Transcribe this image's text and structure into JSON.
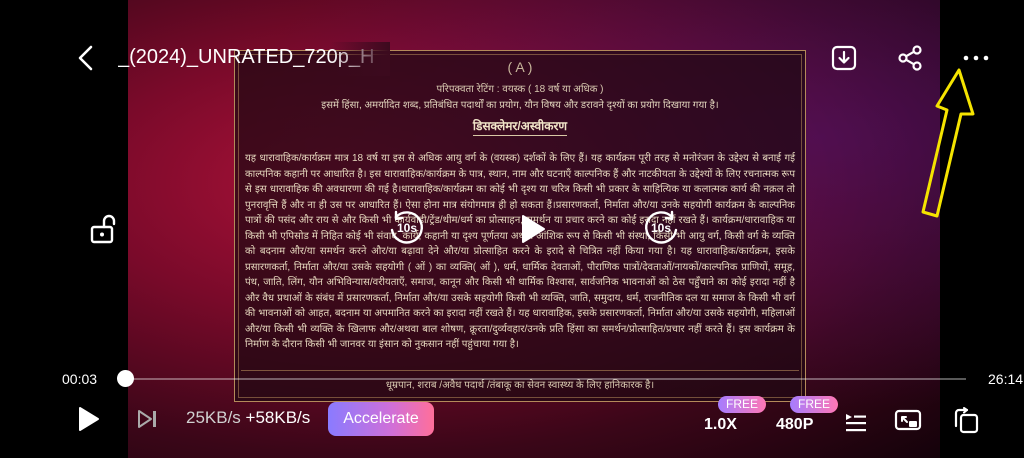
{
  "header": {
    "title": "_(2024)_UNRATED_720p_H"
  },
  "card": {
    "rating_label": "( A )",
    "maturity_line": "परिपक्वता रेटिंग : वयस्क ( 18 वर्ष या अधिक )",
    "content_line": "इसमें हिंसा, अमर्यादित शब्द, प्रतिबंधित पदार्थों का प्रयोग, यौन विषय और डरावने दृश्यों का प्रयोग दिखाया गया है।",
    "heading": "डिसक्लेमर/अस्वीकरण",
    "paragraph": "यह धारावाहिक/कार्यक्रम मात्र 18 वर्ष या इस से अधिक आयु वर्ग के (वयस्क) दर्शकों के लिए हैं। यह कार्यक्रम पूरी तरह से मनोरंजन के उद्देश्य से बनाई गई काल्पनिक कहानी पर आधारित है। इस धारावाहिक/कार्यक्रम के पात्र, स्थान, नाम और घटनाएँ काल्पनिक हैं और नाटकीयता के उद्देश्यों के लिए रचनात्मक रूप से इस धारावाहिक की अवधारणा की गई है।धारावाहिक/कार्यक्रम का कोई भी दृश्य या चरित्र किसी भी प्रकार के साहित्यिक या कलात्मक कार्य की नक़ल तो पुनरावृत्ति हैं और ना ही उस पर आधारित हैं। ऐसा होना मात्र संयोगमात्र ही हो सकता हैं।प्रसारणकर्ता, निर्माता और/या उनके सहयोगी कार्यक्रम के काल्पनिक पात्रों की पसंद और राय से और किसी भी कार्यवाही/ट्रेंड/थीम/धर्म का प्रोत्साहन, समर्थन या प्रचार करने का कोई इरादा नहीं रखते हैं। कार्यक्रम/धारावाहिक या किसी भी एपिसोड में निहित कोई भी संवाद, कार्य, कहानी या दृश्य पूर्णतया अथवा आंशिक रूप से किसी भी संस्था, किसी भी आयु वर्ग, किसी वर्ग के व्यक्ति को बदनाम और/या समर्थन करने और/या बढ़ावा देने और/या प्रोत्साहित करने के इरादे से चित्रित नहीं किया गया है। यह धारावाहिक/कार्यक्रम, इसके प्रसारणकर्ता, निर्माता और/या उसके सहयोगी ( ओं ) का व्यक्ति( ओं ), धर्म, धार्मिक देवताओं, पौराणिक पात्रों/देवताओं/नायकों/काल्पनिक प्राणियों, समूह, पंथ, जाति, लिंग, यौन अभिविन्यास/वरीयताएँ, समाज, कानून और किसी भी धार्मिक विश्वास, सार्वजनिक भावनाओं को ठेस पहुँचाने का कोई इरादा नहीं है और वैध प्रथाओं के संबंध में प्रसारणकर्ता, निर्माता और/या उसके सहयोगी किसी भी व्यक्ति, जाति, समुदाय, धर्म, राजनीतिक दल या समाज के किसी भी वर्ग की भावनाओं को आहत, बदनाम या अपमानित करने का इरादा नहीं रखते हैं। यह धारावाहिक, इसके प्रसारणकर्ता, निर्माता और/या उसके सहयोगी, महिलाओं और/या किसी भी व्यक्ति के खिलाफ और/अथवा बाल शोषण, क्रूरता/दुर्व्यवहार/उनके प्रति हिंसा का समर्थन/प्रोत्साहित/प्रचार नहीं करते हैं। इस कार्यक्रम के निर्माण के दौरान किसी भी जानवर या इंसान को नुकसान नहीं पहुंचाया गया है।",
    "footer_note": "धूम्रपान, शराब /अवैध पदार्थ /तंबाकू का सेवन स्वास्थ्य के लिए हानिकारक है।"
  },
  "controls": {
    "rewind_label": "10s",
    "forward_label": "10s"
  },
  "progress": {
    "current_time": "00:03",
    "total_time": "26:14",
    "fraction": 0.002
  },
  "bottom": {
    "speed_down": "25KB/s",
    "speed_up": "+58KB/s",
    "accelerate_label": "Accelerate",
    "free_badge_speed": "FREE",
    "free_badge_quality": "FREE",
    "playback_speed": "1.0X",
    "quality": "480P"
  },
  "colors": {
    "annotation_arrow": "#f5e400",
    "accent_gradient_start": "#8a7bff",
    "accent_gradient_end": "#ff6f9a"
  }
}
